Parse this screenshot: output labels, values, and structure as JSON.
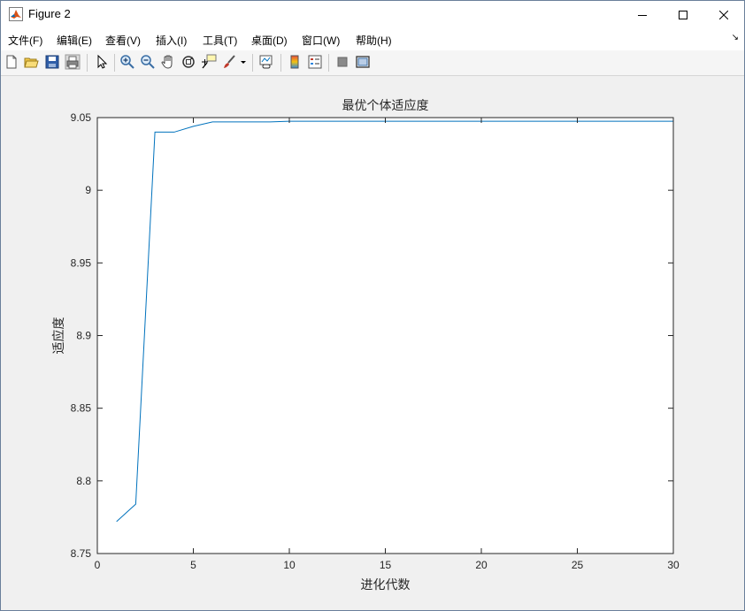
{
  "window": {
    "title": "Figure 2"
  },
  "menu": {
    "items": [
      "文件(F)",
      "编辑(E)",
      "查看(V)",
      "插入(I)",
      "工具(T)",
      "桌面(D)",
      "窗口(W)",
      "帮助(H)"
    ]
  },
  "toolbar": {
    "icons": [
      "new-figure-icon",
      "open-file-icon",
      "save-icon",
      "print-icon",
      "pointer-icon",
      "zoom-in-icon",
      "zoom-out-icon",
      "pan-hand-icon",
      "rotate-3d-icon",
      "data-cursor-icon",
      "brush-icon",
      "link-plot-icon",
      "colorbar-icon",
      "legend-icon",
      "hide-plot-tools-icon",
      "show-plot-tools-icon"
    ]
  },
  "colors": {
    "line": "#0072bd",
    "axes_bg": "#ffffff",
    "figure_bg": "#f0f0f0"
  },
  "chart_data": {
    "type": "line",
    "title": "最优个体适应度",
    "xlabel": "进化代数",
    "ylabel": "适应度",
    "xlim": [
      0,
      30
    ],
    "ylim": [
      8.75,
      9.05
    ],
    "xticks": [
      0,
      5,
      10,
      15,
      20,
      25,
      30
    ],
    "yticks": [
      8.75,
      8.8,
      8.85,
      8.9,
      8.95,
      9,
      9.05
    ],
    "xtick_labels": [
      "0",
      "5",
      "10",
      "15",
      "20",
      "25",
      "30"
    ],
    "ytick_labels": [
      "8.75",
      "8.8",
      "8.85",
      "8.9",
      "8.95",
      "9",
      "9.05"
    ],
    "grid": false,
    "series": [
      {
        "x": [
          1,
          2,
          3,
          4,
          5,
          6,
          7,
          8,
          9,
          10,
          11,
          12,
          13,
          14,
          15,
          16,
          17,
          18,
          19,
          20,
          21,
          22,
          23,
          24,
          25,
          26,
          27,
          28,
          29,
          30
        ],
        "y": [
          8.772,
          8.784,
          9.04,
          9.04,
          9.044,
          9.047,
          9.047,
          9.047,
          9.047,
          9.0475,
          9.0475,
          9.0475,
          9.0475,
          9.0475,
          9.0475,
          9.0475,
          9.0475,
          9.0475,
          9.0475,
          9.0475,
          9.0475,
          9.0475,
          9.0475,
          9.0475,
          9.0475,
          9.0475,
          9.0475,
          9.0475,
          9.0475,
          9.0475
        ]
      }
    ]
  }
}
